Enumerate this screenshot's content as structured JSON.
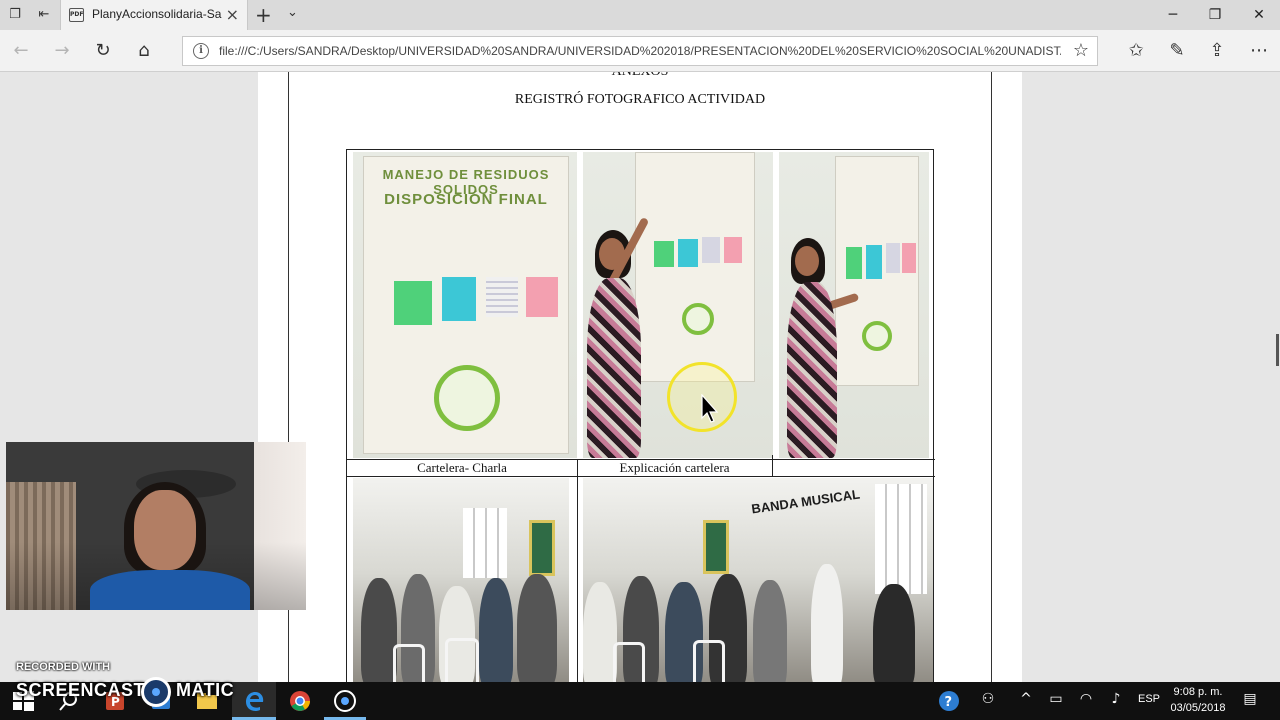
{
  "browser": {
    "tab_title": "PlanyAccionsolidaria-Sa",
    "tab_favicon_label": "PDF",
    "address_url": "file:///C:/Users/SANDRA/Desktop/UNIVERSIDAD%20SANDRA/UNIVERSIDAD%202018/PRESENTACION%20DEL%20SERVICIO%20SOCIAL%20UNADISTA/fase%"
  },
  "document": {
    "heading_anexos": "ANEXOS",
    "heading_registro": "REGISTRÓ FOTOGRAFICO ACTIVIDAD",
    "captions": [
      "Cartelera- Charla",
      "Explicación cartelera"
    ],
    "poster_title_line1": "MANEJO DE RESIDUOS SOLIDOS",
    "poster_title_line2": "DISPOSICIÓN FINAL",
    "wall_text": "BANDA MUSICAL"
  },
  "overlay": {
    "recorded_with": "RECORDED WITH",
    "screencast_brand_1": "SCREENCAST",
    "screencast_brand_2": "MATIC"
  },
  "taskbar": {
    "language": "ESP",
    "time": "9:08 p. m.",
    "date": "03/05/2018"
  },
  "colors": {
    "taskbar_bg": "#101010",
    "accent_blue": "#76b9ed",
    "cursor_highlight": "#f2e32a"
  }
}
